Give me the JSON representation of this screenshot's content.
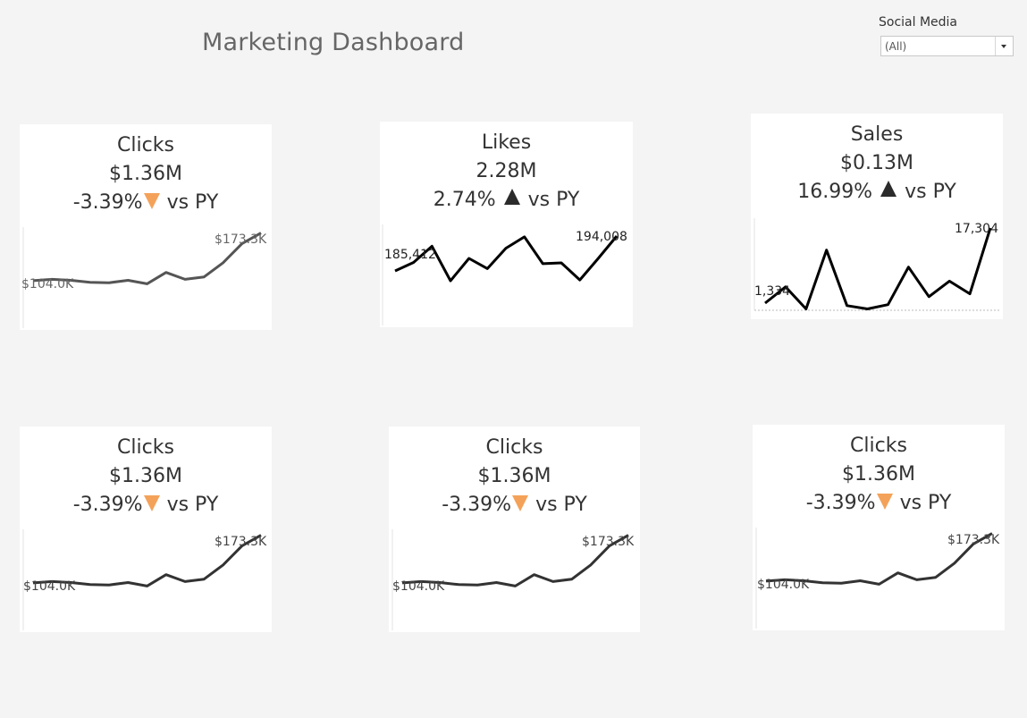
{
  "header": {
    "title": "Marketing Dashboard"
  },
  "filter": {
    "label": "Social Media",
    "value": "(All)",
    "icon": "chevron-down-icon"
  },
  "colors": {
    "background": "#f4f4f4",
    "card": "#ffffff",
    "down_indicator": "#f4a259",
    "up_indicator": "#2b2b2b",
    "line_dark": "#000000",
    "line_grey": "#555555"
  },
  "cards": [
    {
      "name": "Clicks",
      "value": "$1.36M",
      "change": "-3.39%",
      "direction": "down",
      "suffix": "vs PY",
      "start_label": "$104.0K",
      "end_label": "$173.3K",
      "values": [
        104.0,
        106.0,
        104.5,
        101.5,
        101.0,
        104.5,
        99.5,
        116.0,
        106.0,
        109.5,
        130.0,
        158.0,
        173.3
      ],
      "line_color": "#555555"
    },
    {
      "name": "Likes",
      "value": "2.28M",
      "change": "2.74%",
      "direction": "up",
      "suffix": "vs PY",
      "start_label": "185,412",
      "end_label": "194,008",
      "values": [
        185412,
        187500,
        191500,
        183000,
        188500,
        186000,
        191000,
        193800,
        187200,
        187400,
        183200,
        188500,
        194008
      ],
      "line_color": "#000000"
    },
    {
      "name": "Sales",
      "value": "$0.13M",
      "change": "16.99%",
      "direction": "up",
      "suffix": "vs PY",
      "start_label": "1,334",
      "end_label": "17,304",
      "values": [
        1334,
        4800,
        100,
        12600,
        800,
        100,
        1000,
        9000,
        2700,
        6000,
        3300,
        17304
      ],
      "line_color": "#000000"
    },
    {
      "name": "Clicks",
      "value": "$1.36M",
      "change": "-3.39%",
      "direction": "down",
      "suffix": "vs PY",
      "start_label": "$104.0K",
      "end_label": "$173.3K",
      "values": [
        104.0,
        106.0,
        104.5,
        101.5,
        101.0,
        104.5,
        99.5,
        116.0,
        106.0,
        109.5,
        130.0,
        158.0,
        173.3
      ],
      "line_color": "#333333"
    },
    {
      "name": "Clicks",
      "value": "$1.36M",
      "change": "-3.39%",
      "direction": "down",
      "suffix": "vs PY",
      "start_label": "$104.0K",
      "end_label": "$173.3K",
      "values": [
        104.0,
        106.0,
        104.5,
        101.5,
        101.0,
        104.5,
        99.5,
        116.0,
        106.0,
        109.5,
        130.0,
        158.0,
        173.3
      ],
      "line_color": "#333333"
    },
    {
      "name": "Clicks",
      "value": "$1.36M",
      "change": "-3.39%",
      "direction": "down",
      "suffix": "vs PY",
      "start_label": "$104.0K",
      "end_label": "$173.3K",
      "values": [
        104.0,
        106.0,
        104.5,
        101.5,
        101.0,
        104.5,
        99.5,
        116.0,
        106.0,
        109.5,
        130.0,
        158.0,
        173.3
      ],
      "line_color": "#333333"
    }
  ]
}
